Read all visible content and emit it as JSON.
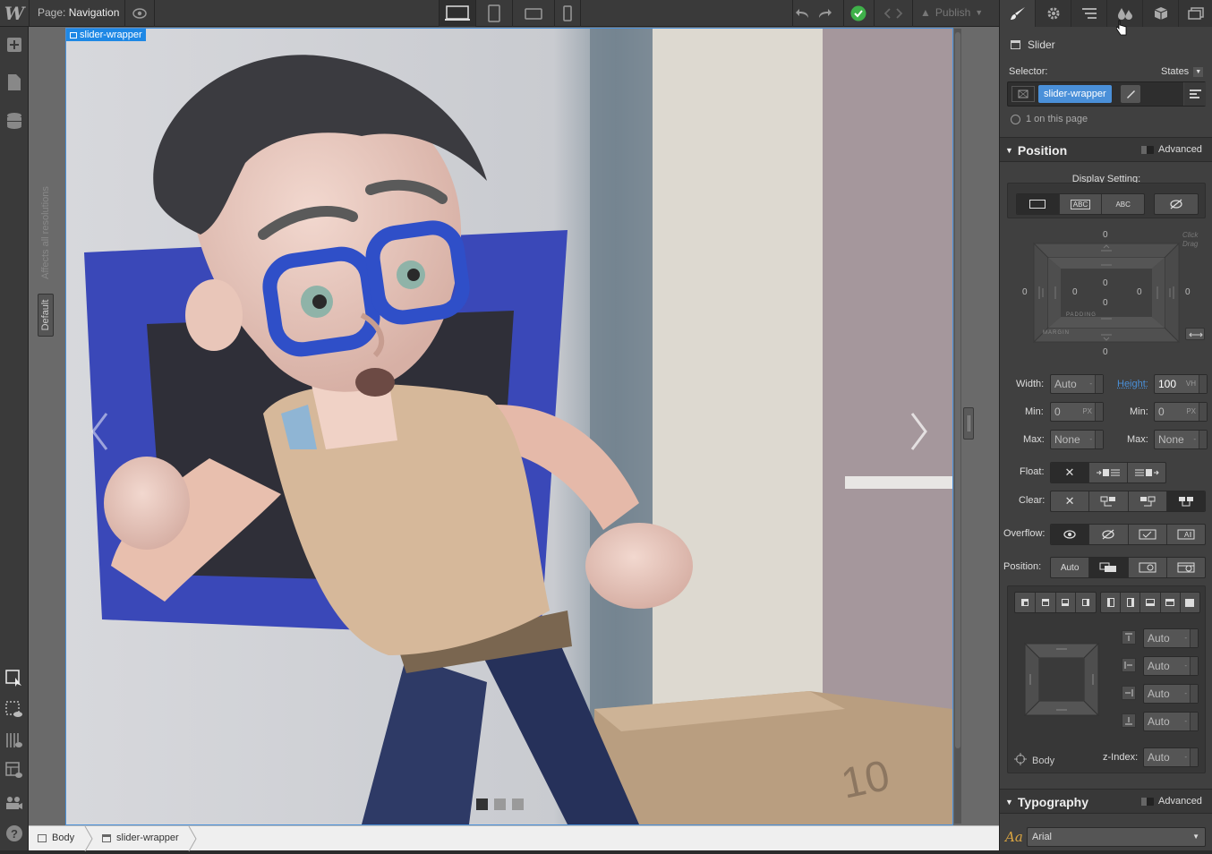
{
  "topbar": {
    "logo": "W",
    "page_prefix": "Page:",
    "page_name": "Navigation",
    "publish_label": "Publish"
  },
  "canvas": {
    "selected_tag": "slider-wrapper",
    "side_label_default": "Default",
    "side_label_affects": "Affects all resolutions",
    "slider_dots": 3,
    "box_number": "10"
  },
  "breadcrumbs": [
    {
      "label": "Body"
    },
    {
      "label": "slider-wrapper"
    }
  ],
  "panel": {
    "element_type": "Slider",
    "selector_label": "Selector:",
    "states_label": "States",
    "selector_class": "slider-wrapper",
    "on_page": "1 on this page",
    "position_section": {
      "title": "Position",
      "advanced_label": "Advanced",
      "display_setting_label": "Display Setting:",
      "display_options": [
        "",
        "ABC",
        "ABC",
        ""
      ],
      "box_model": {
        "margin_top": "0",
        "margin_right": "0",
        "margin_bottom": "0",
        "margin_left": "0",
        "padding_top": "0",
        "padding_right": "0",
        "padding_bottom": "0",
        "padding_left": "0",
        "padding_label": "PADDING",
        "margin_label": "MARGIN",
        "hint": "Click Drag"
      },
      "width_label": "Width:",
      "width_value": "Auto",
      "height_label": "Height:",
      "height_value": "100",
      "height_unit": "VH",
      "min_label": "Min:",
      "min_w_value": "0",
      "min_w_unit": "PX",
      "min_h_value": "0",
      "min_h_unit": "PX",
      "max_label": "Max:",
      "max_w_value": "None",
      "max_h_value": "None",
      "float_label": "Float:",
      "clear_label": "Clear:",
      "overflow_label": "Overflow:",
      "position_label": "Position:",
      "position_options": [
        "Auto",
        "",
        "",
        ""
      ],
      "offsets": [
        "Auto",
        "Auto",
        "Auto",
        "Auto"
      ],
      "relative_to": "Body",
      "zindex_label": "z-Index:",
      "zindex_value": "Auto"
    },
    "typography_section": {
      "title": "Typography",
      "advanced_label": "Advanced",
      "font": "Arial"
    }
  },
  "colors": {
    "accent_blue": "#4a90d9",
    "selection_blue": "#1e88e5",
    "publish_green": "#3fb14a"
  }
}
